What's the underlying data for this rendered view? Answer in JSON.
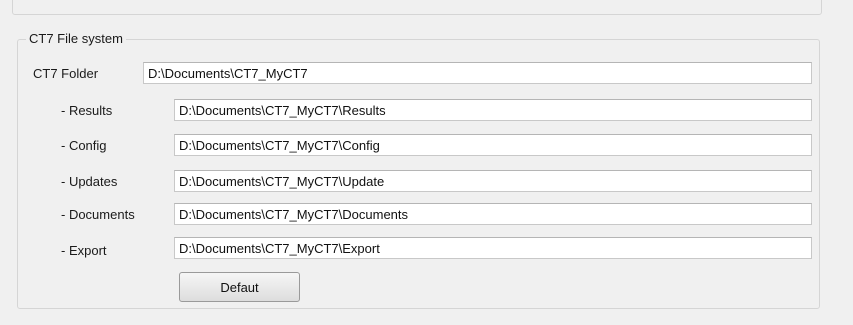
{
  "group": {
    "title": "CT7 File system"
  },
  "ct7_folder": {
    "label": "CT7 Folder",
    "value": "D:\\Documents\\CT7_MyCT7"
  },
  "rows": [
    {
      "label": "- Results",
      "value": "D:\\Documents\\CT7_MyCT7\\Results"
    },
    {
      "label": "- Config",
      "value": "D:\\Documents\\CT7_MyCT7\\Config"
    },
    {
      "label": "- Updates",
      "value": "D:\\Documents\\CT7_MyCT7\\Update"
    },
    {
      "label": "- Documents",
      "value": "D:\\Documents\\CT7_MyCT7\\Documents"
    },
    {
      "label": "- Export",
      "value": "D:\\Documents\\CT7_MyCT7\\Export"
    }
  ],
  "default_button": {
    "label": "Defaut"
  }
}
